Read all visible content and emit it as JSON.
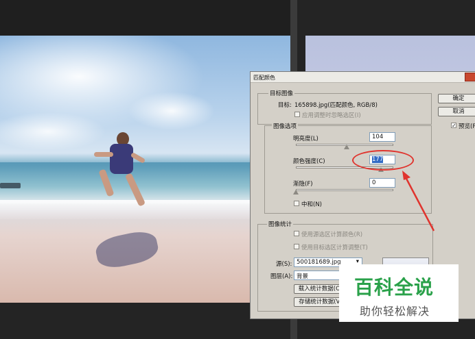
{
  "dialog": {
    "title": "匹配颜色",
    "target_group": {
      "label": "目标图像",
      "target_label": "目标:",
      "target_value": "165898.jpg(匹配颜色, RGB/8)",
      "ignore_selection": "应用调整时忽略选区(I)"
    },
    "image_options": {
      "label": "图像选项",
      "luminance_label": "明亮度(L)",
      "luminance_value": "104",
      "luminance_level": 104,
      "intensity_label": "颜色强度(C)",
      "intensity_value": "177",
      "intensity_level": 177,
      "fade_label": "渐隐(F)",
      "fade_value": "0",
      "fade_level": 0,
      "neutralize_label": "中和(N)"
    },
    "stats_group": {
      "label": "图像统计",
      "use_source_selection": "使用源选区计算颜色(R)",
      "use_target_selection": "使用目标选区计算调整(T)",
      "source_label": "源(S):",
      "source_value": "500181689.jpg",
      "layer_label": "图层(A):",
      "layer_value": "背景",
      "load_stats": "载入统计数据(O)...",
      "save_stats": "存储统计数据(V)..."
    },
    "ok_button": "确定",
    "cancel_button": "取消",
    "preview_label": "预览(P)",
    "preview_checked": true
  },
  "watermark": {
    "brand": "百科全说",
    "tagline": "助你轻松解决"
  },
  "colors": {
    "annotation": "#e0342e",
    "watermark_green": "#2aa14a",
    "dialog_bg": "#d4d0c8"
  }
}
